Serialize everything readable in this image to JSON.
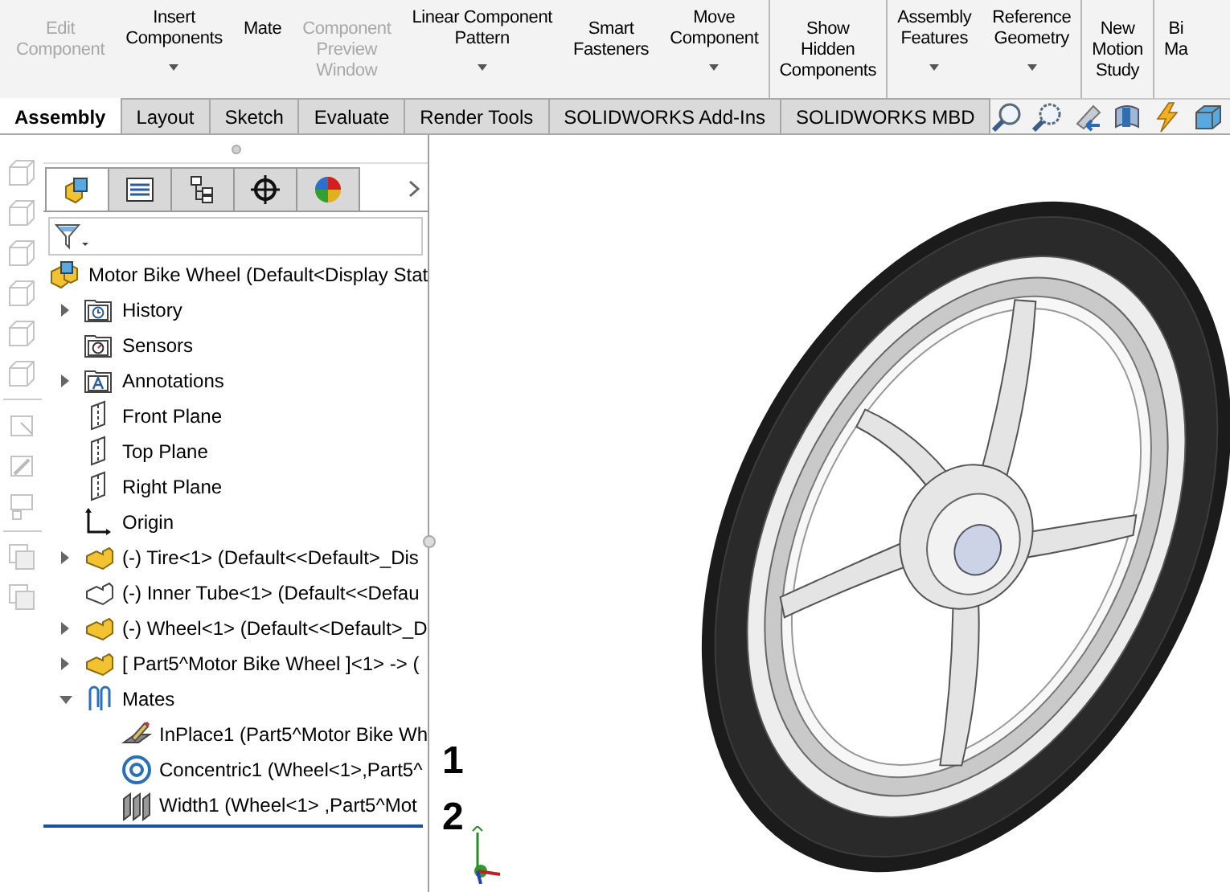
{
  "toolbar": [
    {
      "lines": [
        "Edit",
        "Component"
      ],
      "disabled": true,
      "dropdown": false,
      "group_end": false
    },
    {
      "lines": [
        "Insert",
        "Components"
      ],
      "disabled": false,
      "dropdown": true,
      "group_end": false
    },
    {
      "lines": [
        "Mate"
      ],
      "disabled": false,
      "dropdown": false,
      "group_end": false
    },
    {
      "lines": [
        "Component",
        "Preview",
        "Window"
      ],
      "disabled": true,
      "dropdown": false,
      "group_end": false
    },
    {
      "lines": [
        "Linear Component",
        "Pattern"
      ],
      "disabled": false,
      "dropdown": true,
      "group_end": false
    },
    {
      "lines": [
        "Smart",
        "Fasteners"
      ],
      "disabled": false,
      "dropdown": false,
      "group_end": false
    },
    {
      "lines": [
        "Move",
        "Component"
      ],
      "disabled": false,
      "dropdown": true,
      "group_end": true
    },
    {
      "lines": [
        "Show",
        "Hidden",
        "Components"
      ],
      "disabled": false,
      "dropdown": false,
      "group_end": true
    },
    {
      "lines": [
        "Assembly",
        "Features"
      ],
      "disabled": false,
      "dropdown": true,
      "group_end": false
    },
    {
      "lines": [
        "Reference",
        "Geometry"
      ],
      "disabled": false,
      "dropdown": true,
      "group_end": true
    },
    {
      "lines": [
        "New",
        "Motion",
        "Study"
      ],
      "disabled": false,
      "dropdown": false,
      "group_end": true
    },
    {
      "lines": [
        "Bi",
        "Ma"
      ],
      "disabled": false,
      "dropdown": false,
      "group_end": false
    }
  ],
  "tabs": [
    {
      "label": "Assembly",
      "selected": true
    },
    {
      "label": "Layout",
      "selected": false
    },
    {
      "label": "Sketch",
      "selected": false
    },
    {
      "label": "Evaluate",
      "selected": false
    },
    {
      "label": "Render Tools",
      "selected": false
    },
    {
      "label": "SOLIDWORKS Add-Ins",
      "selected": false
    },
    {
      "label": "SOLIDWORKS MBD",
      "selected": false
    }
  ],
  "panel_tabs": [
    {
      "kind": "feature-tree",
      "selected": true
    },
    {
      "kind": "property",
      "selected": false
    },
    {
      "kind": "configuration",
      "selected": false
    },
    {
      "kind": "dimxpert",
      "selected": false
    },
    {
      "kind": "appearance",
      "selected": false
    }
  ],
  "tree": [
    {
      "label": "Motor Bike Wheel  (Default<Display Stat",
      "kind": "assembly",
      "children": [
        {
          "label": "History",
          "kind": "history",
          "expanded": false
        },
        {
          "label": "Sensors",
          "kind": "sensors"
        },
        {
          "label": "Annotations",
          "kind": "annotations",
          "expanded": false
        },
        {
          "label": "Front Plane",
          "kind": "plane"
        },
        {
          "label": "Top Plane",
          "kind": "plane"
        },
        {
          "label": "Right Plane",
          "kind": "plane"
        },
        {
          "label": "Origin",
          "kind": "origin"
        },
        {
          "label": "(-) Tire<1> (Default<<Default>_Dis",
          "kind": "part",
          "expanded": false
        },
        {
          "label": "(-) Inner Tube<1> (Default<<Defau",
          "kind": "part-outline"
        },
        {
          "label": "(-) Wheel<1> (Default<<Default>_D",
          "kind": "part",
          "expanded": false
        },
        {
          "label": "[ Part5^Motor Bike Wheel ]<1> -> (",
          "kind": "part",
          "expanded": false
        },
        {
          "label": "Mates",
          "kind": "mates",
          "expanded": true,
          "children": [
            {
              "label": "InPlace1 (Part5^Motor Bike Wh",
              "kind": "inplace"
            },
            {
              "label": "Concentric1 (Wheel<1>,Part5^",
              "kind": "concentric"
            },
            {
              "label": "Width1 (Wheel<1> ,Part5^Mot",
              "kind": "width"
            }
          ]
        }
      ]
    }
  ],
  "viewport_labels": [
    "1",
    "2"
  ]
}
